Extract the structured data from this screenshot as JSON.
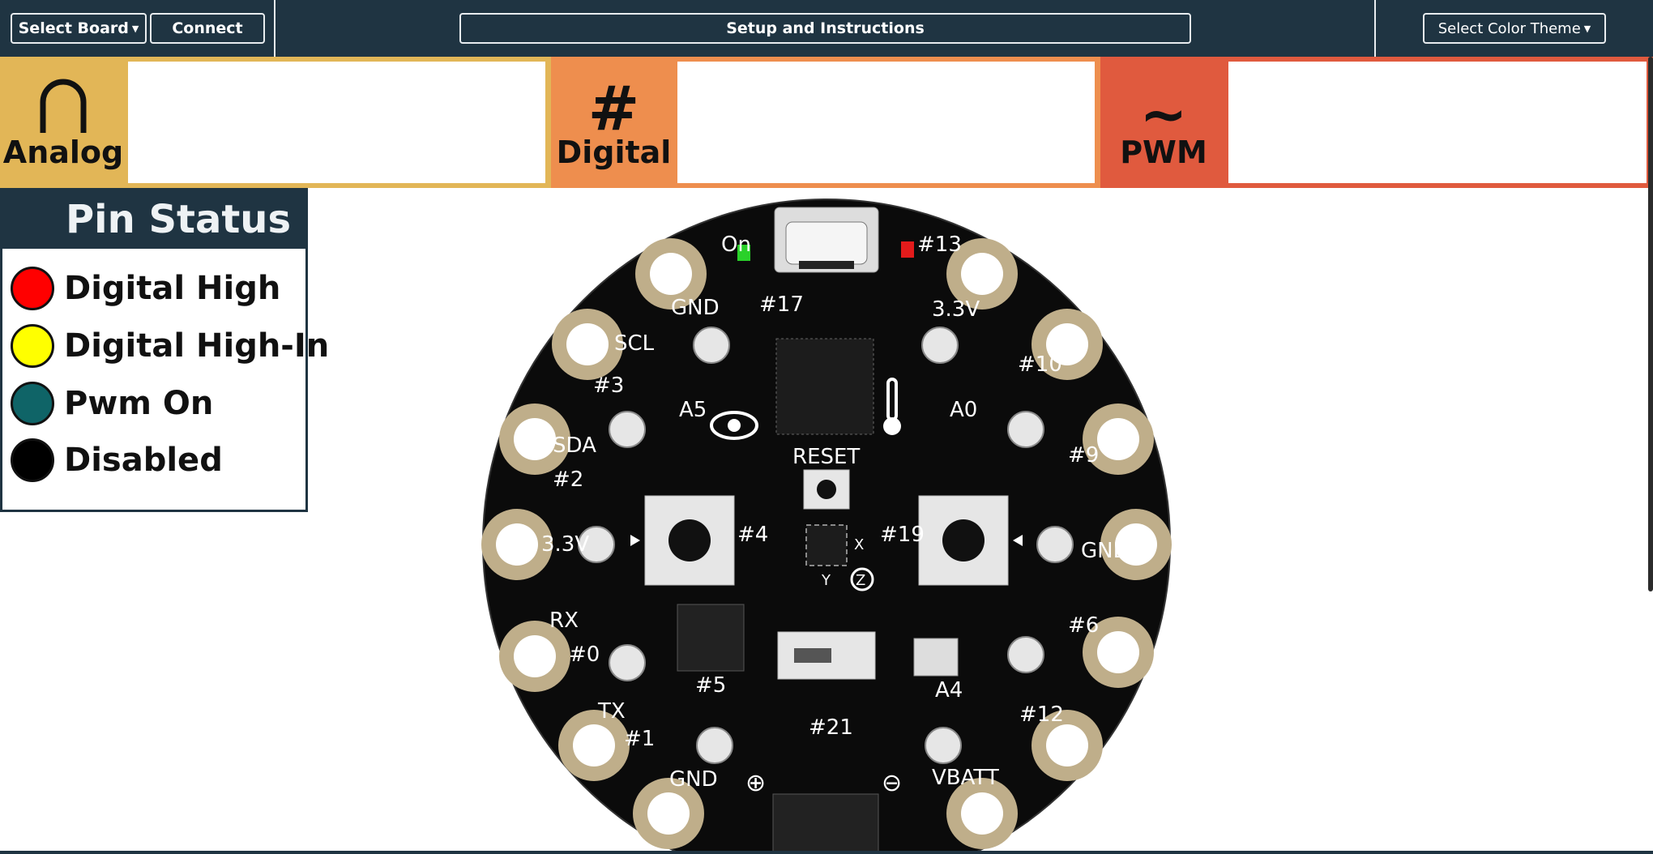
{
  "toolbar": {
    "select_board": "Select Board",
    "connect": "Connect",
    "setup": "Setup and Instructions",
    "theme": "Select Color Theme"
  },
  "panels": {
    "analog": {
      "symbol": "∩",
      "label": "Analog",
      "color": "#e2b657"
    },
    "digital": {
      "symbol": "#",
      "label": "Digital",
      "color": "#ee8e4e"
    },
    "pwm": {
      "symbol": "~",
      "label": "PWM",
      "color": "#e05a3e"
    }
  },
  "pin_status": {
    "title": "Pin Status",
    "items": [
      {
        "label": "Digital High",
        "color": "#ff0000"
      },
      {
        "label": "Digital High-In",
        "color": "#ffff00"
      },
      {
        "label": "Pwm On",
        "color": "#0f6467"
      },
      {
        "label": "Disabled",
        "color": "#000000"
      }
    ]
  },
  "board_labels": {
    "on": "On",
    "pin13": "#13",
    "gnd_top": "GND",
    "pin17": "#17",
    "v33_top": "3.3V",
    "scl": "SCL",
    "pin3": "#3",
    "pin10": "#10",
    "a5": "A5",
    "a0": "A0",
    "sda": "SDA",
    "pin2": "#2",
    "pin9": "#9",
    "reset": "RESET",
    "pin4": "#4",
    "pin19": "#19",
    "v33_left": "3.3V",
    "gnd_right": "GND",
    "x": "X",
    "y": "Y",
    "z": "Z",
    "rx": "RX",
    "pin0": "#0",
    "pin6": "#6",
    "tx": "TX",
    "pin1": "#1",
    "pin5": "#5",
    "a4": "A4",
    "pin12": "#12",
    "pin21": "#21",
    "gnd_bottom": "GND",
    "vbatt": "VBATT",
    "plus": "⊕",
    "minus": "⊖"
  }
}
